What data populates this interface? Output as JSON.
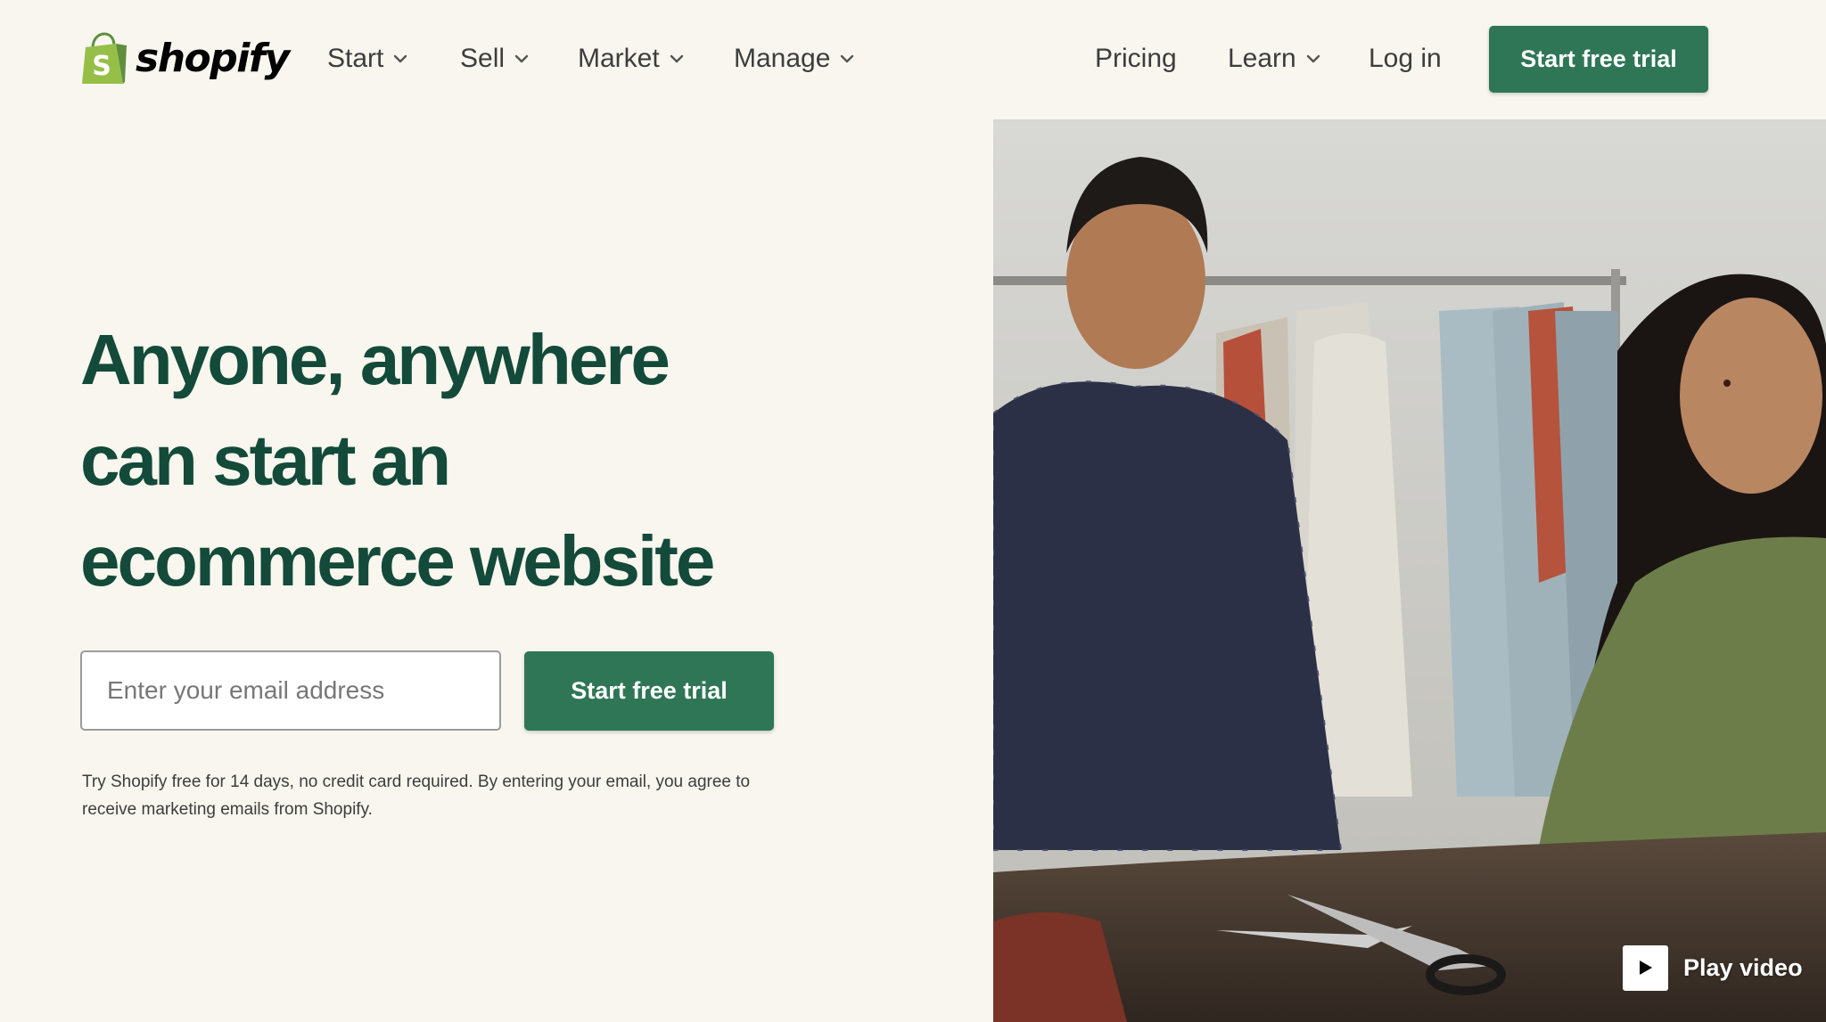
{
  "brand": {
    "name": "shopify",
    "colors": {
      "primary_green": "#2f7656",
      "headline_green": "#134a39",
      "logo_green": "#95bf47",
      "background": "#f8f6ee"
    }
  },
  "nav": {
    "left_items": [
      {
        "label": "Start",
        "has_dropdown": true,
        "icon": "chevron-down-icon"
      },
      {
        "label": "Sell",
        "has_dropdown": true,
        "icon": "chevron-down-icon"
      },
      {
        "label": "Market",
        "has_dropdown": true,
        "icon": "chevron-down-icon"
      },
      {
        "label": "Manage",
        "has_dropdown": true,
        "icon": "chevron-down-icon"
      }
    ],
    "right_items": [
      {
        "label": "Pricing",
        "has_dropdown": false
      },
      {
        "label": "Learn",
        "has_dropdown": true,
        "icon": "chevron-down-icon"
      },
      {
        "label": "Log in",
        "has_dropdown": false
      }
    ],
    "cta_label": "Start free trial"
  },
  "hero": {
    "headline_lines": [
      "Anyone, anywhere",
      "can start an",
      "ecommerce website"
    ],
    "email": {
      "placeholder": "Enter your email address",
      "value": ""
    },
    "cta_label": "Start free trial",
    "disclaimer": "Try Shopify free for 14 days, no credit card required. By entering your email, you agree to receive marketing emails from Shopify."
  },
  "media": {
    "play_label": "Play video",
    "play_icon": "play-icon"
  }
}
